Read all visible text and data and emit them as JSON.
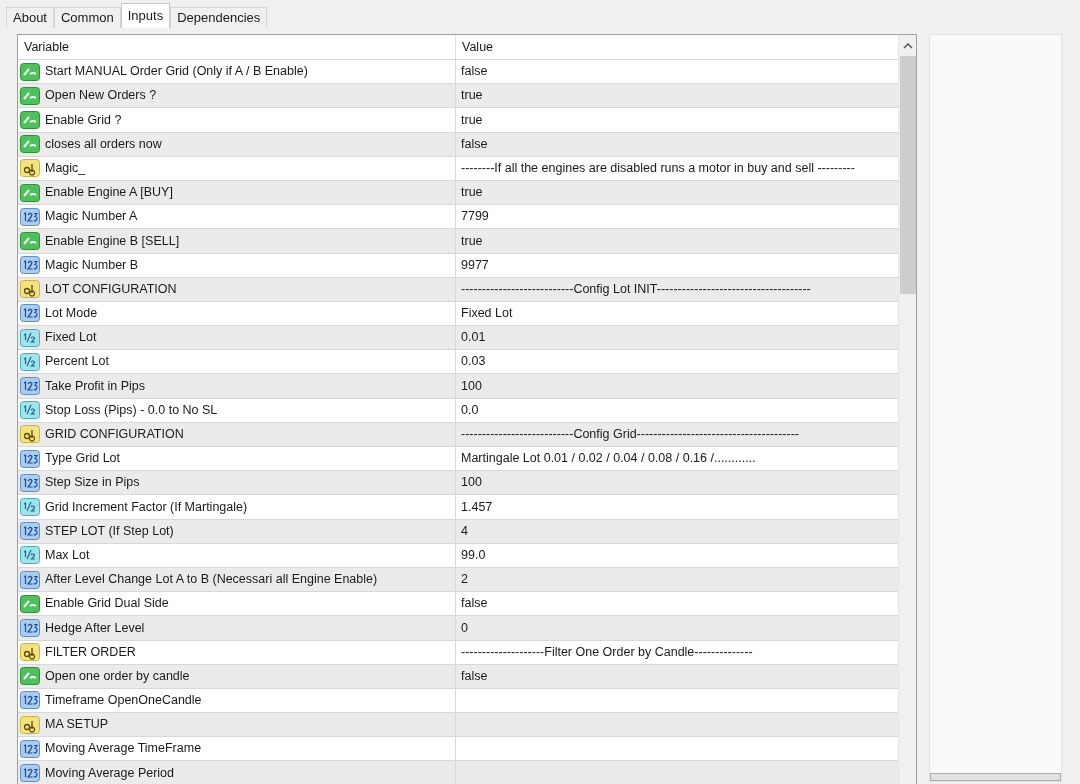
{
  "tabs": [
    {
      "label": "About",
      "selected": false
    },
    {
      "label": "Common",
      "selected": false
    },
    {
      "label": "Inputs",
      "selected": true
    },
    {
      "label": "Dependencies",
      "selected": false
    }
  ],
  "table": {
    "columns": [
      "Variable",
      "Value"
    ],
    "rows": [
      {
        "kind": "bool",
        "variable": "Start MANUAL Order  Grid  (Only if A / B Enable)",
        "value": "false"
      },
      {
        "kind": "bool",
        "variable": "Open New Orders ?",
        "value": "true"
      },
      {
        "kind": "bool",
        "variable": "Enable Grid ?",
        "value": "true"
      },
      {
        "kind": "bool",
        "variable": "closes all orders now",
        "value": "false"
      },
      {
        "kind": "string",
        "variable": "Magic_",
        "value": "--------If all the engines are disabled runs a motor in buy and sell ---------"
      },
      {
        "kind": "bool",
        "variable": "Enable Engine A   [BUY]",
        "value": "true"
      },
      {
        "kind": "int",
        "variable": "Magic Number  A",
        "value": "7799"
      },
      {
        "kind": "bool",
        "variable": "Enable Engine B   [SELL]",
        "value": "true"
      },
      {
        "kind": "int",
        "variable": "Magic Number  B",
        "value": "9977"
      },
      {
        "kind": "string",
        "variable": "LOT CONFIGURATION",
        "value": "---------------------------Config Lot INIT-------------------------------------"
      },
      {
        "kind": "int",
        "variable": "Lot Mode",
        "value": "Fixed Lot"
      },
      {
        "kind": "double",
        "variable": "Fixed Lot",
        "value": "0.01"
      },
      {
        "kind": "double",
        "variable": "Percent Lot",
        "value": "0.03"
      },
      {
        "kind": "int",
        "variable": "Take Profit in Pips",
        "value": "100"
      },
      {
        "kind": "double",
        "variable": "Stop Loss (Pips) - 0.0 to No SL",
        "value": "0.0"
      },
      {
        "kind": "string",
        "variable": "GRID CONFIGURATION",
        "value": "---------------------------Config Grid---------------------------------------"
      },
      {
        "kind": "int",
        "variable": "Type Grid Lot",
        "value": "Martingale Lot  0.01 / 0.02 / 0.04 / 0.08 / 0.16 /............"
      },
      {
        "kind": "int",
        "variable": "Step Size in Pips",
        "value": "100"
      },
      {
        "kind": "double",
        "variable": "Grid Increment Factor (If Martingale)",
        "value": "1.457"
      },
      {
        "kind": "int",
        "variable": "STEP LOT (If Step Lot)",
        "value": "4"
      },
      {
        "kind": "double",
        "variable": "Max Lot",
        "value": "99.0"
      },
      {
        "kind": "int",
        "variable": "After Level Change Lot A to B (Necessari all Engine Enable)",
        "value": "2"
      },
      {
        "kind": "bool",
        "variable": "Enable Grid Dual Side",
        "value": "false"
      },
      {
        "kind": "int",
        "variable": "Hedge After Level",
        "value": "0"
      },
      {
        "kind": "string",
        "variable": "FILTER ORDER",
        "value": "--------------------Filter One Order by Candle--------------"
      },
      {
        "kind": "bool",
        "variable": "Open one order by candle",
        "value": "false"
      },
      {
        "kind": "int",
        "variable": "Timeframe OpenOneCandle"
      },
      {
        "kind": "string",
        "variable": "MA SETUP"
      },
      {
        "kind": "int",
        "variable": "Moving Average TimeFrame"
      },
      {
        "kind": "int",
        "variable": "Moving Average Period"
      }
    ]
  }
}
